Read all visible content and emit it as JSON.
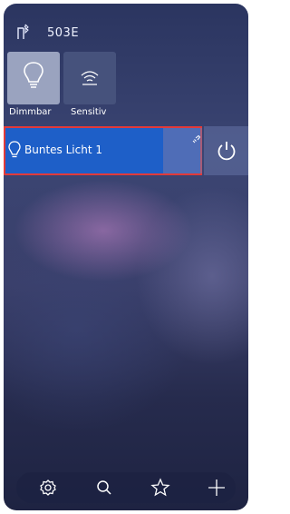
{
  "header": {
    "room_icon": "room-door-bluetooth-icon",
    "title": "503E"
  },
  "types": [
    {
      "label": "Dimmbar",
      "icon": "bulb-icon",
      "selected": true
    },
    {
      "label": "Sensitiv",
      "icon": "sensor-wave-icon",
      "selected": false
    }
  ],
  "devices": [
    {
      "name": "Buntes Licht 1",
      "icon": "bulb-icon",
      "link_icon": "link-icon",
      "power_icon": "power-icon",
      "color": "#1e5fc8"
    }
  ],
  "bottom_nav": [
    {
      "icon": "settings-icon"
    },
    {
      "icon": "search-icon"
    },
    {
      "icon": "favorites-star-icon"
    },
    {
      "icon": "add-plus-icon"
    }
  ],
  "colors": {
    "accent": "#1e5fc8",
    "highlight_border": "#e23a3a",
    "selected_tile": "#9aa3bf"
  }
}
